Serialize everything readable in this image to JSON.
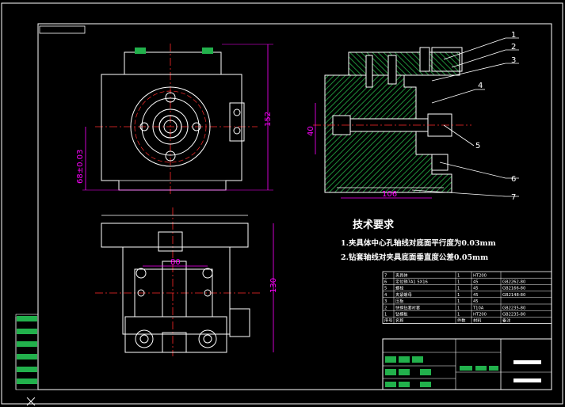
{
  "colors": {
    "background": "#000000",
    "outline": "#ffffff",
    "dimension": "#ff00ff",
    "centerline": "#ff2a2a",
    "hatch": "#1f8f3a",
    "hatch_dark": "#0f5a22",
    "fastener": "#cfcfcf",
    "title_block_green": "#22b14c"
  },
  "dimensions": {
    "front_height": "152",
    "front_width": "68±0.03",
    "section_height": "40",
    "section_width": "106",
    "plan_height": "130",
    "plan_width": "80"
  },
  "balloons": [
    "1",
    "2",
    "3",
    "4",
    "5",
    "6",
    "7"
  ],
  "tech_requirements": {
    "title": "技术要求",
    "lines": [
      "1.夹具体中心孔轴线对底面平行度为0.03mm",
      "2.钻套轴线对夹具底面垂直度公差0.05mm"
    ]
  },
  "parts_list": {
    "rows": [
      {
        "no": "7",
        "name": "夹具体",
        "qty": "1",
        "material": "HT200",
        "std": ""
      },
      {
        "no": "6",
        "name": "定位销7A1 5X16",
        "qty": "1",
        "material": "45",
        "std": "GB2262-80"
      },
      {
        "no": "5",
        "name": "螺栓",
        "qty": "1",
        "material": "45",
        "std": "GB2166-80"
      },
      {
        "no": "4",
        "name": "夹紧螺母",
        "qty": "1",
        "material": "45",
        "std": "GB2148-80"
      },
      {
        "no": "3",
        "name": "压板",
        "qty": "1",
        "material": "45",
        "std": ""
      },
      {
        "no": "2",
        "name": "快换钻套衬套",
        "qty": "1",
        "material": "T10A",
        "std": "GB2235-80"
      },
      {
        "no": "1",
        "name": "钻模板",
        "qty": "1",
        "material": "HT200",
        "std": "GB2235-80"
      }
    ],
    "header": {
      "no": "序号",
      "name": "名称",
      "qty": "件数",
      "material": "材料",
      "std": "备注"
    }
  }
}
